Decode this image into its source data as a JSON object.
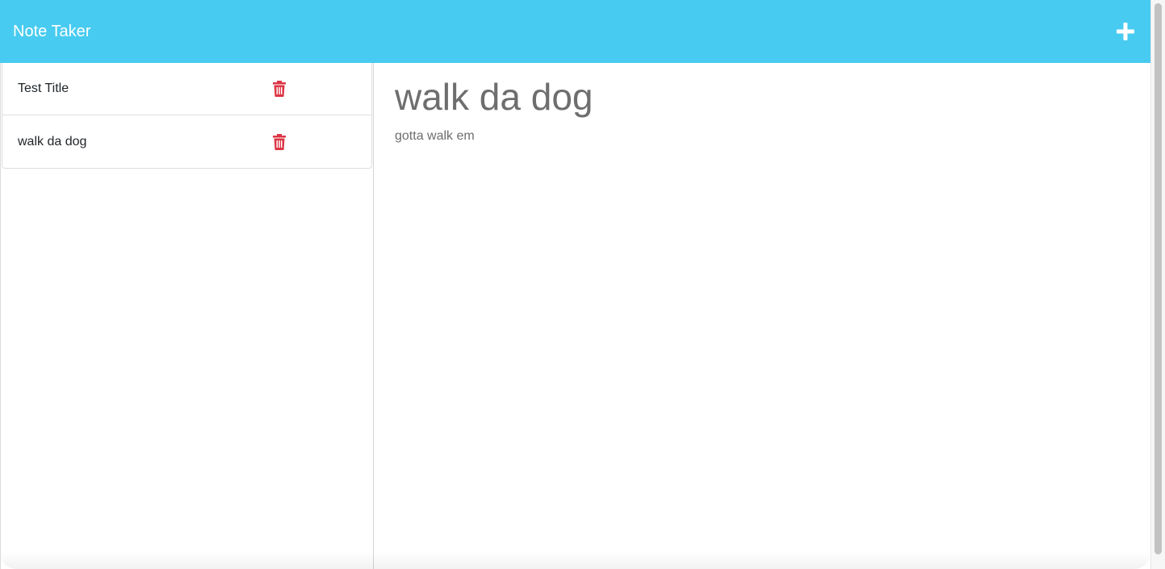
{
  "navbar": {
    "brand": "Note Taker",
    "add_icon": "plus-icon",
    "bg_color": "#48cbf0"
  },
  "notes": [
    {
      "title": "Test Title",
      "delete_icon": "trash-icon"
    },
    {
      "title": "walk da dog",
      "delete_icon": "trash-icon"
    }
  ],
  "active_note": {
    "title": "walk da dog",
    "text": "gotta walk em"
  },
  "colors": {
    "delete": "#dc3545",
    "note_text": "#6e6e6e"
  }
}
